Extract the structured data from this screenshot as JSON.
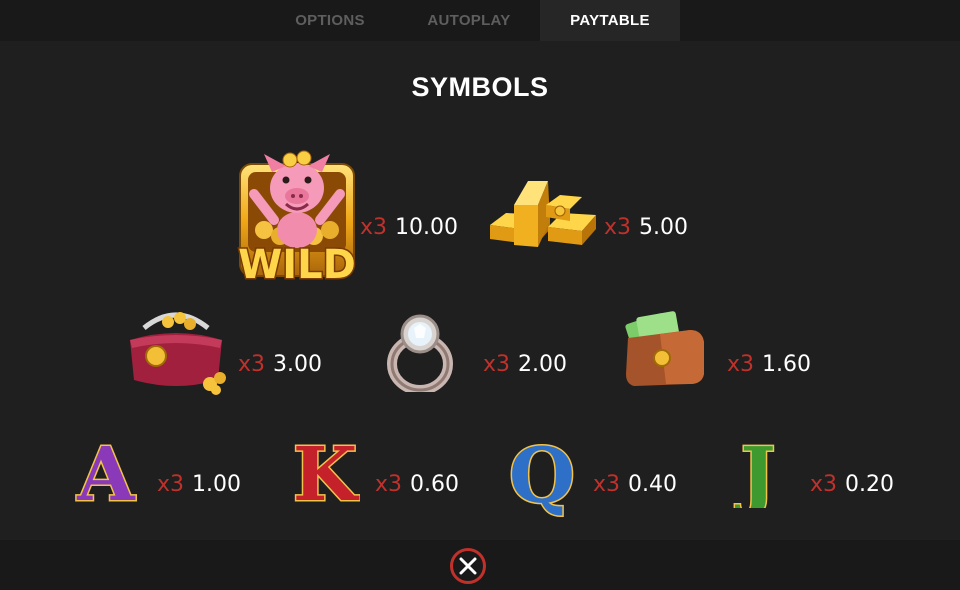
{
  "tabs": [
    {
      "label": "OPTIONS",
      "active": false
    },
    {
      "label": "AUTOPLAY",
      "active": false
    },
    {
      "label": "PAYTABLE",
      "active": true
    }
  ],
  "section_title": "SYMBOLS",
  "symbols": [
    {
      "name": "wild-pig",
      "icon_text": "WILD",
      "multiplier": "x3",
      "value": "10.00"
    },
    {
      "name": "gold-bars",
      "multiplier": "x3",
      "value": "5.00"
    },
    {
      "name": "purse",
      "multiplier": "x3",
      "value": "3.00"
    },
    {
      "name": "diamond-ring",
      "multiplier": "x3",
      "value": "2.00"
    },
    {
      "name": "wallet",
      "multiplier": "x3",
      "value": "1.60"
    },
    {
      "name": "letter-a",
      "icon_text": "A",
      "multiplier": "x3",
      "value": "1.00"
    },
    {
      "name": "letter-k",
      "icon_text": "K",
      "multiplier": "x3",
      "value": "0.60"
    },
    {
      "name": "letter-q",
      "icon_text": "Q",
      "multiplier": "x3",
      "value": "0.40"
    },
    {
      "name": "letter-j",
      "icon_text": "J",
      "multiplier": "x3",
      "value": "0.20"
    }
  ],
  "colors": {
    "multiplier": "#c0312b",
    "close_ring": "#c0312b",
    "background": "#1f1f1f",
    "bar": "#191919"
  },
  "close_icon": "close-icon"
}
